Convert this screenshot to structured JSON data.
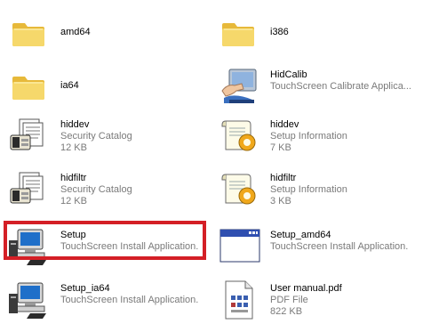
{
  "files": [
    {
      "key": "amd64",
      "name": "amd64",
      "sub1": "",
      "sub2": "",
      "icon": "folder-icon"
    },
    {
      "key": "i386",
      "name": "i386",
      "sub1": "",
      "sub2": "",
      "icon": "folder-icon"
    },
    {
      "key": "ia64",
      "name": "ia64",
      "sub1": "",
      "sub2": "",
      "icon": "folder-icon"
    },
    {
      "key": "hidcalib",
      "name": "HidCalib",
      "sub1": "TouchScreen Calibrate Applica...",
      "sub2": "",
      "icon": "calibrate-app-icon"
    },
    {
      "key": "hiddev-cat",
      "name": "hiddev",
      "sub1": "Security Catalog",
      "sub2": "12 KB",
      "icon": "security-catalog-icon"
    },
    {
      "key": "hiddev-inf",
      "name": "hiddev",
      "sub1": "Setup Information",
      "sub2": "7 KB",
      "icon": "setup-information-icon"
    },
    {
      "key": "hidfiltr-cat",
      "name": "hidfiltr",
      "sub1": "Security Catalog",
      "sub2": "12 KB",
      "icon": "security-catalog-icon"
    },
    {
      "key": "hidfiltr-inf",
      "name": "hidfiltr",
      "sub1": "Setup Information",
      "sub2": "3 KB",
      "icon": "setup-information-icon"
    },
    {
      "key": "setup",
      "name": "Setup",
      "sub1": "TouchScreen Install Application.",
      "sub2": "",
      "icon": "setup-computer-icon"
    },
    {
      "key": "setup-amd64",
      "name": "Setup_amd64",
      "sub1": "TouchScreen Install Application.",
      "sub2": "",
      "icon": "application-window-icon"
    },
    {
      "key": "setup-ia64",
      "name": "Setup_ia64",
      "sub1": "TouchScreen Install Application.",
      "sub2": "",
      "icon": "setup-computer-icon"
    },
    {
      "key": "user-manual",
      "name": "User manual.pdf",
      "sub1": "PDF File",
      "sub2": "822 KB",
      "icon": "pdf-file-icon"
    }
  ],
  "colors": {
    "highlight": "#d41f26",
    "subtext": "#7a7a7a",
    "folder": "#f3cf55"
  }
}
